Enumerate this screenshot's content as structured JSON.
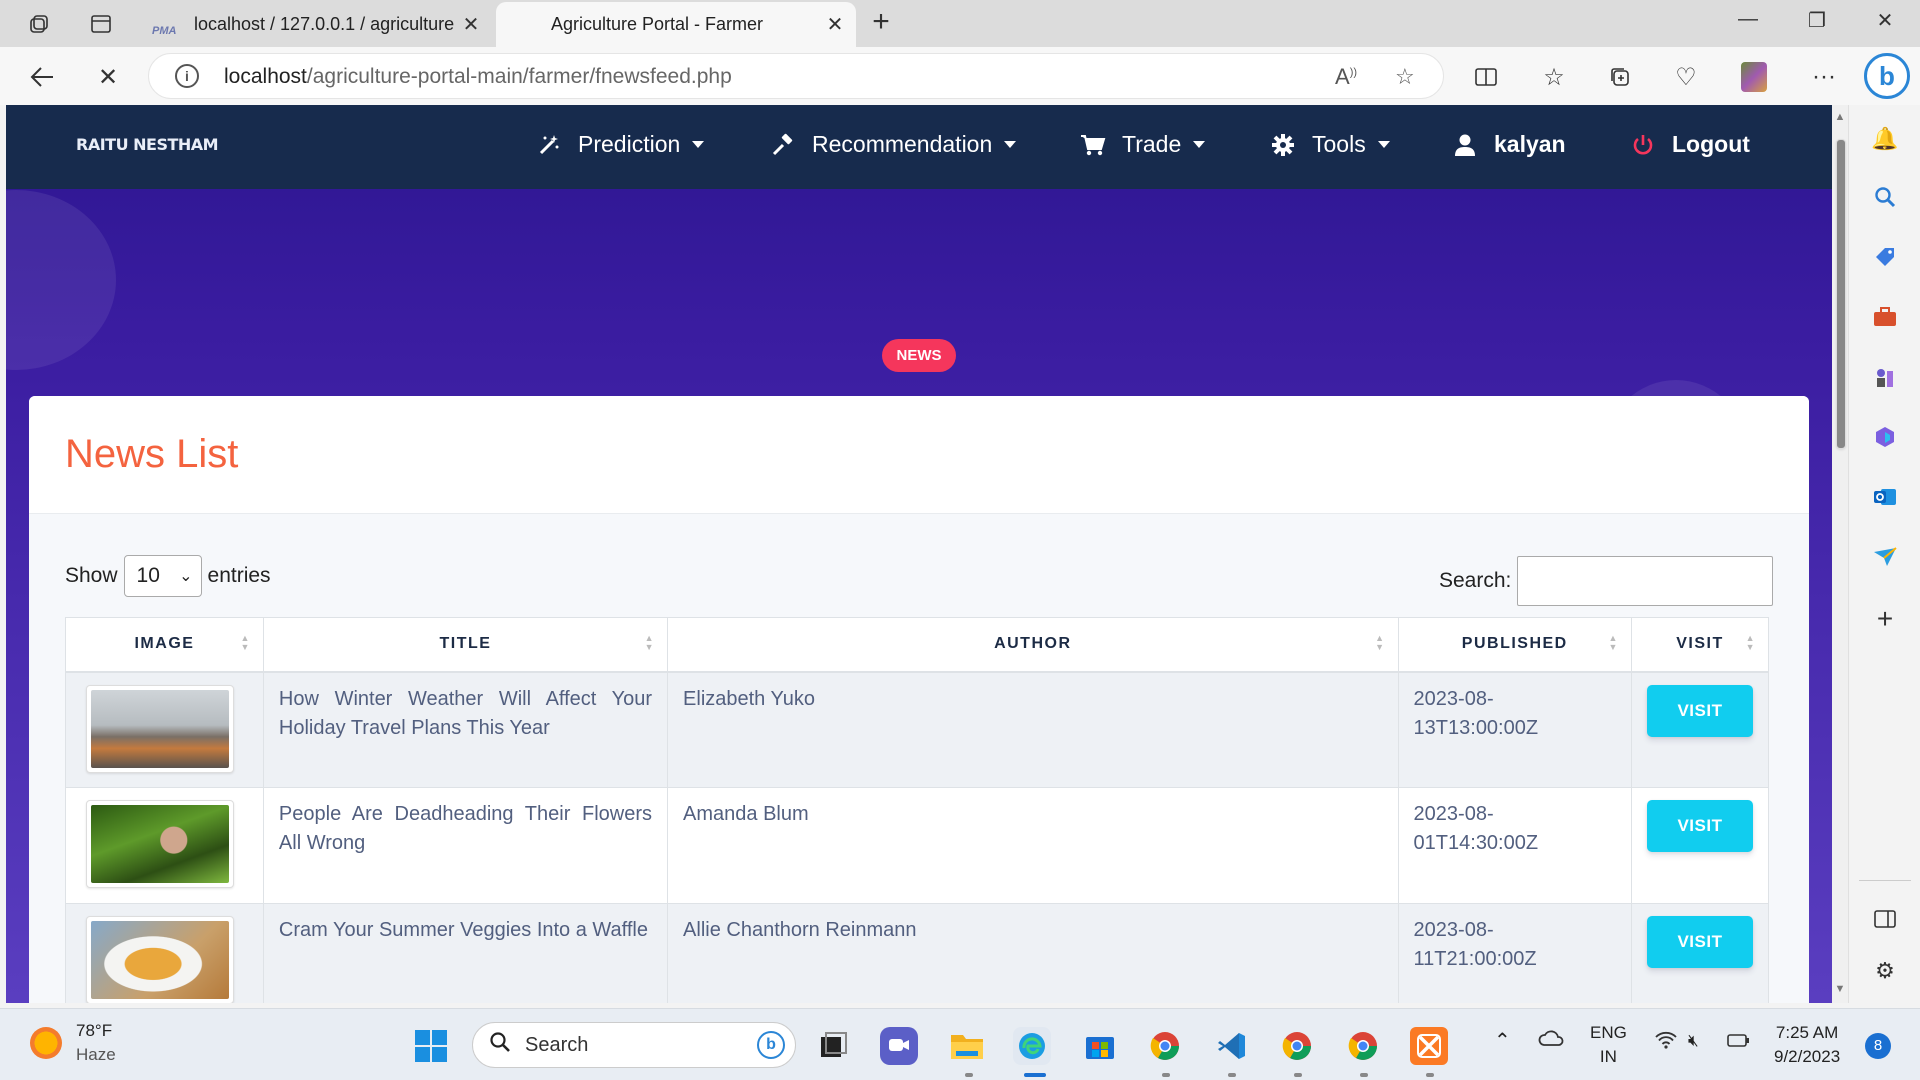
{
  "browser": {
    "tabs": [
      {
        "label": "localhost / 127.0.0.1 / agriculture",
        "favicon": "PMA"
      },
      {
        "label": "Agriculture Portal - Farmer"
      }
    ],
    "url_host": "localhost",
    "url_path": "/agriculture-portal-main/farmer/fnewsfeed.php"
  },
  "navbar": {
    "brand": "RAITU NESTHAM",
    "items": [
      {
        "label": "Prediction",
        "icon": "magic-wand-icon"
      },
      {
        "label": "Recommendation",
        "icon": "gavel-icon"
      },
      {
        "label": "Trade",
        "icon": "cart-icon"
      },
      {
        "label": "Tools",
        "icon": "gear-icon"
      },
      {
        "label": "kalyan",
        "icon": "user-icon"
      },
      {
        "label": "Logout",
        "icon": "power-icon"
      }
    ]
  },
  "hero": {
    "badge": "NEWS"
  },
  "card": {
    "title": "News List",
    "show_label": "Show",
    "entries_value": "10",
    "entries_label": "entries",
    "search_label": "Search:"
  },
  "table": {
    "headers": [
      "IMAGE",
      "TITLE",
      "AUTHOR",
      "PUBLISHED",
      "VISIT"
    ],
    "rows": [
      {
        "title": "How Winter Weather Will Affect Your Holiday Travel Plans This Year",
        "author": "Elizabeth Yuko",
        "published": "2023-08-13T13:00:00Z",
        "visit": "VISIT"
      },
      {
        "title": "People Are Deadheading Their Flowers All Wrong",
        "author": "Amanda Blum",
        "published": "2023-08-01T14:30:00Z",
        "visit": "VISIT"
      },
      {
        "title": "Cram Your Summer Veggies Into a Waffle",
        "author": "Allie Chanthorn Reinmann",
        "published": "2023-08-11T21:00:00Z",
        "visit": "VISIT"
      }
    ]
  },
  "taskbar": {
    "temp": "78°F",
    "condition": "Haze",
    "search_placeholder": "Search",
    "lang_1": "ENG",
    "lang_2": "IN",
    "time": "7:25 AM",
    "date": "9/2/2023",
    "notifications": "8"
  }
}
